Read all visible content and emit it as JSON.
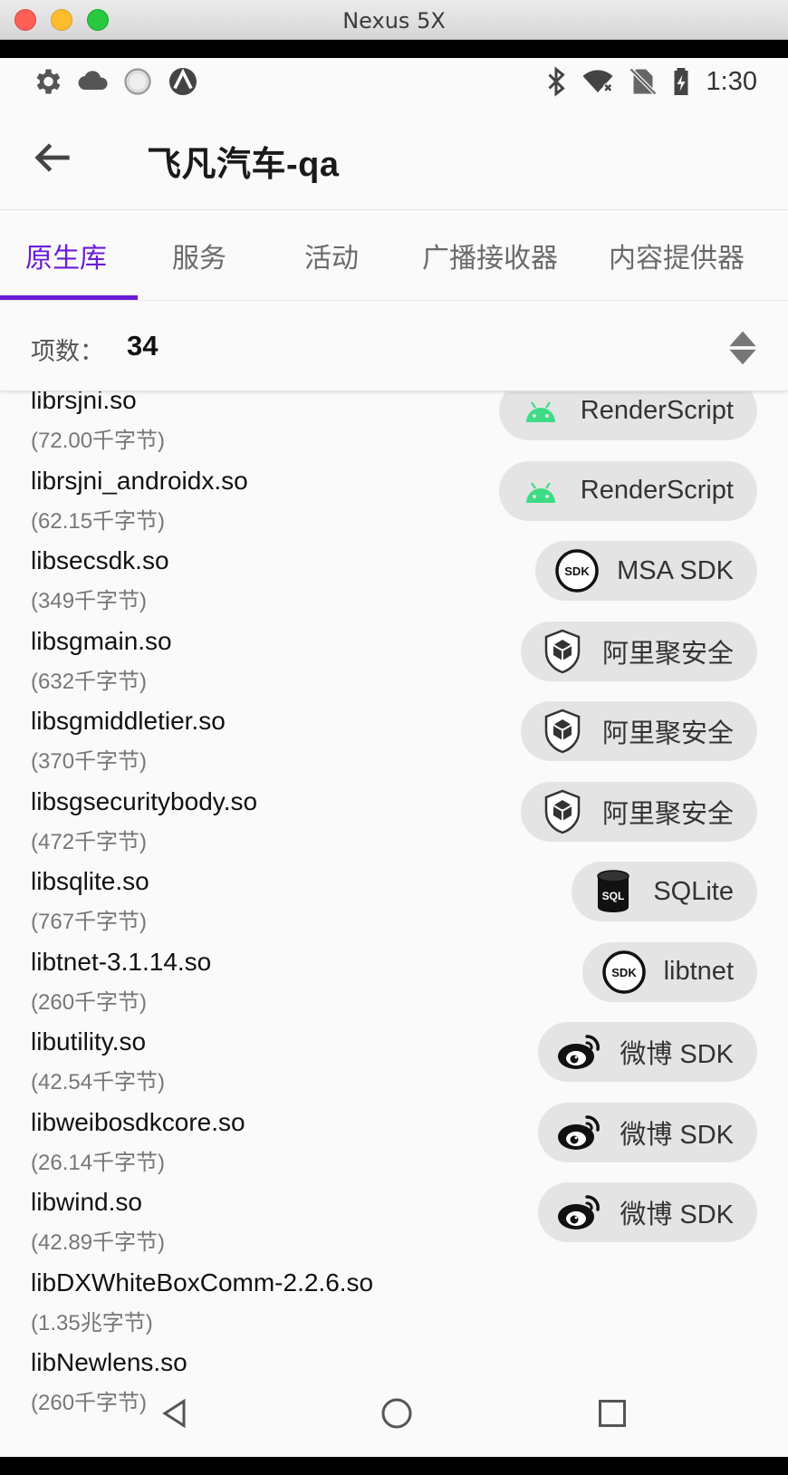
{
  "window": {
    "title": "Nexus 5X"
  },
  "status": {
    "time": "1:30"
  },
  "appbar": {
    "title": "飞凡汽车-qa"
  },
  "tabs": [
    {
      "label": "原生库",
      "active": true
    },
    {
      "label": "服务"
    },
    {
      "label": "活动"
    },
    {
      "label": "广播接收器"
    },
    {
      "label": "内容提供器"
    }
  ],
  "count": {
    "label": "项数：",
    "value": "34"
  },
  "items": [
    {
      "name": "librsjni.so",
      "size": "(72.00千字节)",
      "chip": "RenderScript",
      "icon": "android-icon"
    },
    {
      "name": "librsjni_androidx.so",
      "size": "(62.15千字节)",
      "chip": "RenderScript",
      "icon": "android-icon"
    },
    {
      "name": "libsecsdk.so",
      "size": "(349千字节)",
      "chip": "MSA SDK",
      "icon": "sdk-icon"
    },
    {
      "name": "libsgmain.so",
      "size": "(632千字节)",
      "chip": "阿里聚安全",
      "icon": "shield-icon"
    },
    {
      "name": "libsgmiddletier.so",
      "size": "(370千字节)",
      "chip": "阿里聚安全",
      "icon": "shield-icon"
    },
    {
      "name": "libsgsecuritybody.so",
      "size": "(472千字节)",
      "chip": "阿里聚安全",
      "icon": "shield-icon"
    },
    {
      "name": "libsqlite.so",
      "size": "(767千字节)",
      "chip": "SQLite",
      "icon": "sqlite-icon"
    },
    {
      "name": "libtnet-3.1.14.so",
      "size": "(260千字节)",
      "chip": "libtnet",
      "icon": "sdk-icon"
    },
    {
      "name": "libutility.so",
      "size": "(42.54千字节)",
      "chip": "微博 SDK",
      "icon": "weibo-icon"
    },
    {
      "name": "libweibosdkcore.so",
      "size": "(26.14千字节)",
      "chip": "微博 SDK",
      "icon": "weibo-icon"
    },
    {
      "name": "libwind.so",
      "size": "(42.89千字节)",
      "chip": "微博 SDK",
      "icon": "weibo-icon"
    },
    {
      "name": "libDXWhiteBoxComm-2.2.6.so",
      "size": "(1.35兆字节)",
      "chip": "",
      "icon": ""
    },
    {
      "name": "libNewlens.so",
      "size": "(260千字节)",
      "chip": "",
      "icon": ""
    }
  ],
  "colors": {
    "accent": "#6a1bd8",
    "android": "#3ddc84",
    "chip_bg": "#e4e4e4"
  }
}
